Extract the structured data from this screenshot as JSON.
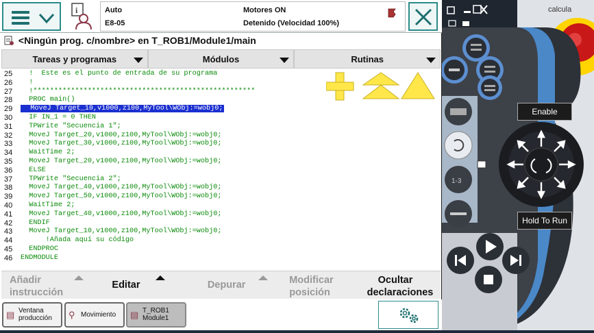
{
  "status": {
    "mode": "Auto",
    "system": "E8-05",
    "motors": "Motores ON",
    "state": "Detenido (Velocidad 100%)"
  },
  "path": "<Ningún prog. c/nombre> en T_ROB1/Module1/main",
  "tabs": [
    "Tareas y programas",
    "Módulos",
    "Rutinas"
  ],
  "code_lines": [
    {
      "n": "25",
      "t": "  !  Este es el punto de entrada de su programa"
    },
    {
      "n": "26",
      "t": "  !"
    },
    {
      "n": "27",
      "t": "  !*****************************************************"
    },
    {
      "n": "28",
      "t": "  PROC main()"
    },
    {
      "n": "29",
      "t": "  MoveJ Target_10,v1000,z100,MyTool\\WObj:=wobj0;",
      "hl": true
    },
    {
      "n": "30",
      "t": "  IF IN_1 = 0 THEN"
    },
    {
      "n": "31",
      "t": "  TPWrite \"Secuencia 1\";"
    },
    {
      "n": "32",
      "t": "  MoveJ Target_20,v1000,z100,MyTool\\WObj:=wobj0;"
    },
    {
      "n": "33",
      "t": "  MoveJ Target_30,v1000,z100,MyTool\\WObj:=wobj0;"
    },
    {
      "n": "34",
      "t": "  WaitTime 2;"
    },
    {
      "n": "35",
      "t": "  MoveJ Target_20,v1000,z100,MyTool\\WObj:=wobj0;"
    },
    {
      "n": "36",
      "t": "  ELSE"
    },
    {
      "n": "37",
      "t": "  TPWrite \"Secuencia 2\";"
    },
    {
      "n": "38",
      "t": "  MoveJ Target_40,v1000,z100,MyTool\\WObj:=wobj0;"
    },
    {
      "n": "39",
      "t": "  MoveJ Target_50,v1000,z100,MyTool\\WObj:=wobj0;"
    },
    {
      "n": "40",
      "t": "  WaitTime 2;"
    },
    {
      "n": "41",
      "t": "  MoveJ Target_40,v1000,z100,MyTool\\WObj:=wobj0;"
    },
    {
      "n": "42",
      "t": "  ENDIF"
    },
    {
      "n": "43",
      "t": "  MoveJ Target_10,v1000,z100,MyTool\\WObj:=wobj0;"
    },
    {
      "n": "44",
      "t": "      !Añada aquí su código"
    },
    {
      "n": "45",
      "t": "  ENDPROC"
    },
    {
      "n": "46",
      "t": "ENDMODULE"
    }
  ],
  "toolbar": {
    "add_instruction": [
      "Añadir",
      "instrucción"
    ],
    "edit": "Editar",
    "debug": "Depurar",
    "modify_position": [
      "Modificar",
      "posición"
    ],
    "hide_declarations": [
      "Ocultar",
      "declaraciones"
    ]
  },
  "taskbar": [
    {
      "label": [
        "Ventana",
        "producción"
      ]
    },
    {
      "label": [
        "Movimiento"
      ]
    },
    {
      "label": [
        "T_ROB1",
        "Module1"
      ]
    }
  ],
  "pendant": {
    "enable": "Enable",
    "hold_to_run": "Hold To Run",
    "peek_text": "calcula"
  },
  "colors": {
    "accent": "#2b8a8a",
    "code": "#0a8a0a",
    "highlight": "#1a2fd0",
    "nav_arrows": "#ffe74a"
  }
}
